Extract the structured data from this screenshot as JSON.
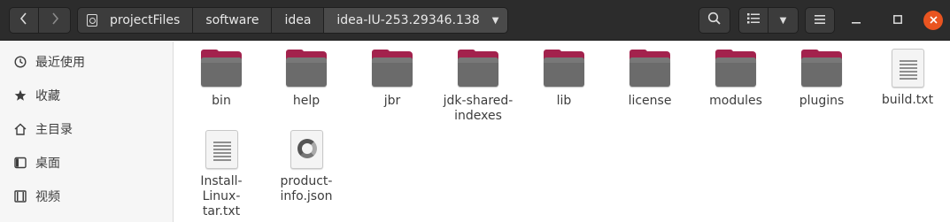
{
  "toolbar": {
    "back_icon": "chevron-left-icon",
    "forward_icon": "chevron-right-icon",
    "path": [
      "projectFiles",
      "software",
      "idea",
      "idea-IU-253.29346.138"
    ],
    "search_icon": "search-icon",
    "view_icon": "list-view-icon",
    "menu_icon": "hamburger-menu-icon",
    "minimize_icon": "minimize-icon",
    "maximize_icon": "maximize-icon",
    "close_icon": "close-icon",
    "close_color": "#e95420"
  },
  "sidebar": {
    "items": [
      {
        "label": "最近使用",
        "icon": "clock-icon"
      },
      {
        "label": "收藏",
        "icon": "star-icon"
      },
      {
        "label": "主目录",
        "icon": "home-icon"
      },
      {
        "label": "桌面",
        "icon": "desktop-icon"
      },
      {
        "label": "视频",
        "icon": "video-icon"
      }
    ]
  },
  "files": [
    {
      "name": "bin",
      "type": "folder"
    },
    {
      "name": "help",
      "type": "folder"
    },
    {
      "name": "jbr",
      "type": "folder"
    },
    {
      "name": "jdk-shared-indexes",
      "type": "folder"
    },
    {
      "name": "lib",
      "type": "folder"
    },
    {
      "name": "license",
      "type": "folder"
    },
    {
      "name": "modules",
      "type": "folder"
    },
    {
      "name": "plugins",
      "type": "folder"
    },
    {
      "name": "build.txt",
      "type": "text"
    },
    {
      "name": "Install-Linux-tar.txt",
      "type": "text"
    },
    {
      "name": "product-info.json",
      "type": "json"
    }
  ],
  "colors": {
    "folder_tab": "#a3224d",
    "folder_body": "#6b6b6b",
    "accent": "#e95420"
  }
}
